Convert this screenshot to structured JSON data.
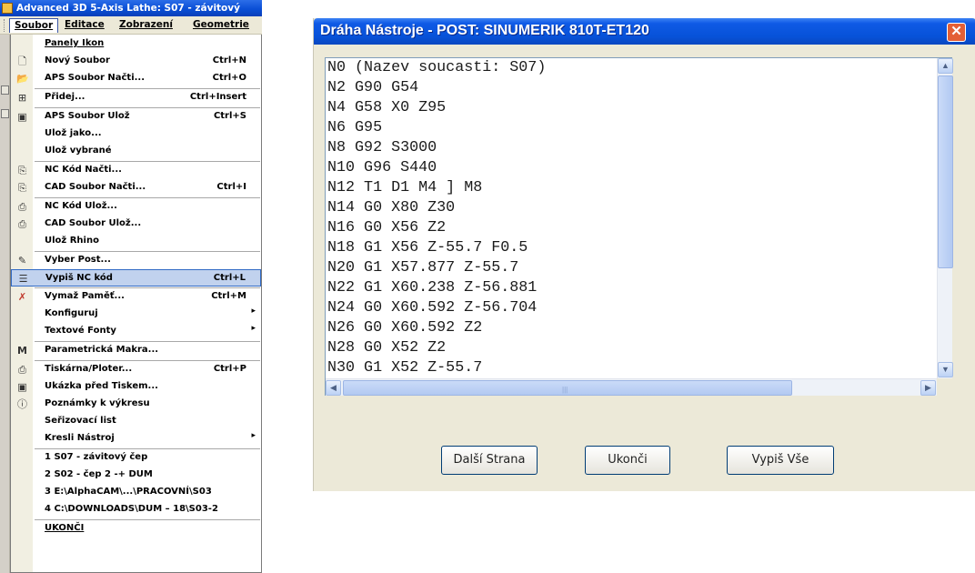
{
  "app": {
    "title": "Advanced 3D 5-Axis Lathe: S07 - závitový",
    "menubar": [
      {
        "label": "Soubor"
      },
      {
        "label": "Editace"
      },
      {
        "label": "Zobrazení"
      },
      {
        "label": "Geometrie"
      }
    ]
  },
  "file_menu": {
    "items": [
      {
        "label": "Panely Ikon",
        "accel": "",
        "icon": "none"
      },
      {
        "label": "Nový Soubor",
        "accel": "Ctrl+N",
        "icon": "new-file-icon"
      },
      {
        "label": "APS Soubor Načti...",
        "accel": "Ctrl+O",
        "icon": "open-folder-icon"
      },
      {
        "label": "Přidej...",
        "accel": "Ctrl+Insert",
        "icon": "insert-icon"
      },
      {
        "label": "APS Soubor Ulož",
        "accel": "Ctrl+S",
        "icon": "save-icon"
      },
      {
        "label": "Ulož jako...",
        "accel": "",
        "icon": "none"
      },
      {
        "label": "Ulož vybrané",
        "accel": "",
        "icon": "none"
      },
      {
        "label": "NC Kód Načti...",
        "accel": "",
        "icon": "nc-open-icon"
      },
      {
        "label": "CAD Soubor Načti...",
        "accel": "Ctrl+I",
        "icon": "cad-open-icon"
      },
      {
        "label": "NC Kód Ulož...",
        "accel": "",
        "icon": "nc-save-icon"
      },
      {
        "label": "CAD Soubor Ulož...",
        "accel": "",
        "icon": "cad-save-icon"
      },
      {
        "label": "Ulož Rhino",
        "accel": "",
        "icon": "none"
      },
      {
        "label": "Vyber Post...",
        "accel": "",
        "icon": "post-icon"
      },
      {
        "label": "Vypiš NC kód",
        "accel": "Ctrl+L",
        "icon": "list-icon"
      },
      {
        "label": "Vymaž Paměť...",
        "accel": "Ctrl+M",
        "icon": "clear-icon"
      },
      {
        "label": "Konfiguruj",
        "accel": "",
        "icon": "none",
        "submenu": true
      },
      {
        "label": "Textové Fonty",
        "accel": "",
        "icon": "none",
        "submenu": true
      },
      {
        "label": "Parametrická Makra...",
        "accel": "",
        "icon": "macro-icon"
      },
      {
        "label": "Tiskárna/Ploter...",
        "accel": "Ctrl+P",
        "icon": "printer-icon"
      },
      {
        "label": "Ukázka před Tiskem...",
        "accel": "",
        "icon": "preview-icon"
      },
      {
        "label": "Poznámky k výkresu",
        "accel": "",
        "icon": "info-icon"
      },
      {
        "label": "Seřizovací list",
        "accel": "",
        "icon": "none"
      },
      {
        "label": "Kresli Nástroj",
        "accel": "",
        "icon": "none",
        "submenu": true
      },
      {
        "label": "1 S07 - závitový čep",
        "accel": "",
        "icon": "none"
      },
      {
        "label": "2 S02 - čep 2 -+ DUM",
        "accel": "",
        "icon": "none"
      },
      {
        "label": "3 E:\\AlphaCAM\\...\\PRACOVNÍ\\S03",
        "accel": "",
        "icon": "none"
      },
      {
        "label": "4 C:\\DOWNLOADS\\DUM – 18\\S03-2",
        "accel": "",
        "icon": "none"
      },
      {
        "label": "UKONČI",
        "accel": "",
        "icon": "none"
      }
    ]
  },
  "dialog": {
    "title": "Dráha Nástroje - POST: SINUMERIK 810T-ET120",
    "code_lines": [
      "N0 (Nazev soucasti: S07)",
      "N2 G90 G54",
      "N4 G58 X0 Z95",
      "N6 G95",
      "N8 G92 S3000",
      "N10 G96 S440",
      "N12 T1 D1 M4 ] M8",
      "N14 G0 X80 Z30",
      "N16 G0 X56 Z2",
      "N18 G1 X56 Z-55.7 F0.5",
      "N20 G1 X57.877 Z-55.7",
      "N22 G1 X60.238 Z-56.881",
      "N24 G0 X60.592 Z-56.704",
      "N26 G0 X60.592 Z2",
      "N28 G0 X52 Z2",
      "N30 G1 X52 Z-55.7"
    ],
    "buttons": {
      "next_page": "Další Strana",
      "close": "Ukonči",
      "print_all": "Vypiš Vše"
    },
    "close_glyph": "✕"
  }
}
